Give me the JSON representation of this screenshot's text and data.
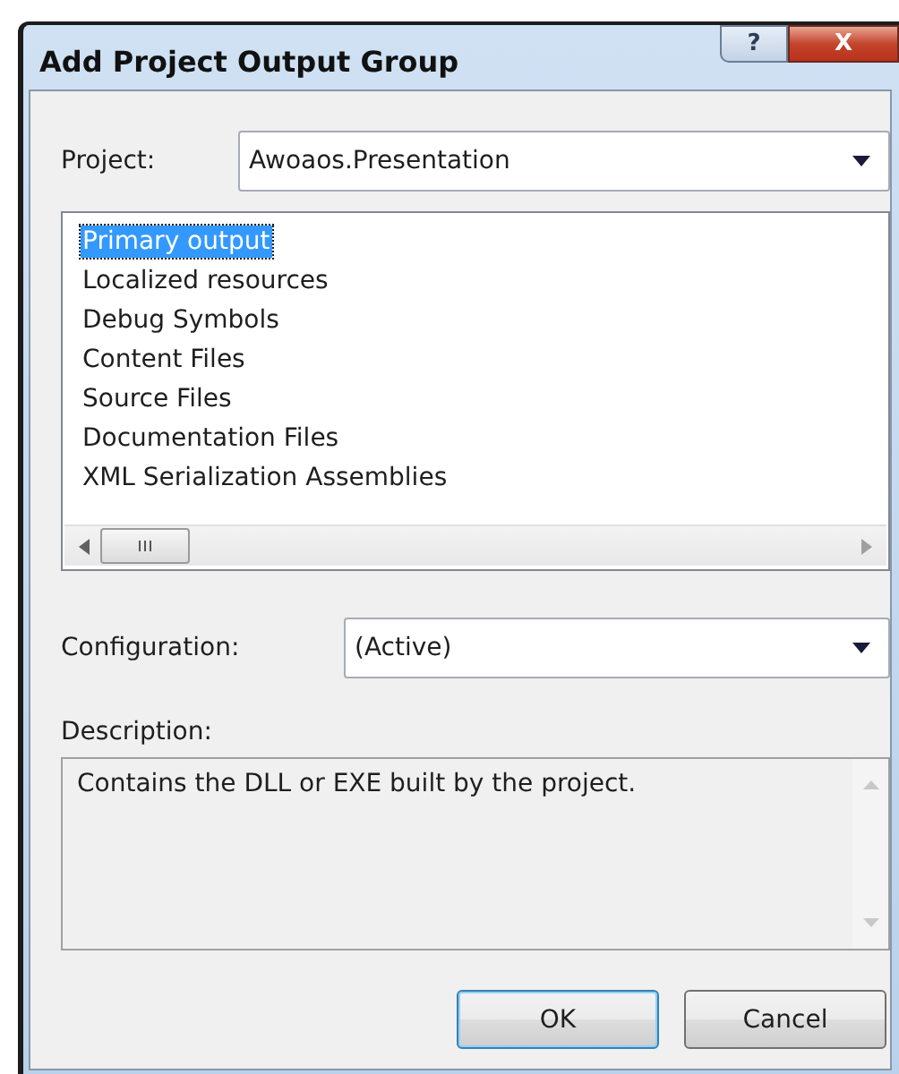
{
  "window": {
    "title": "Add Project Output Group",
    "caption_buttons": [
      {
        "kind": "help",
        "label": "?"
      },
      {
        "kind": "close",
        "label": "X"
      }
    ]
  },
  "project": {
    "label": "Project:",
    "value": "Awoaos.Presentation"
  },
  "outputs": [
    {
      "label": "Primary output",
      "selected": true
    },
    {
      "label": "Localized resources",
      "selected": false
    },
    {
      "label": "Debug Symbols",
      "selected": false
    },
    {
      "label": "Content Files",
      "selected": false
    },
    {
      "label": "Source Files",
      "selected": false
    },
    {
      "label": "Documentation Files",
      "selected": false
    },
    {
      "label": "XML Serialization Assemblies",
      "selected": false
    }
  ],
  "configuration": {
    "label": "Configuration:",
    "value": "(Active)"
  },
  "description": {
    "label": "Description:",
    "text": "Contains the DLL or EXE built by the project."
  },
  "buttons": [
    {
      "label": "OK",
      "default": true
    },
    {
      "label": "Cancel",
      "default": false
    }
  ]
}
